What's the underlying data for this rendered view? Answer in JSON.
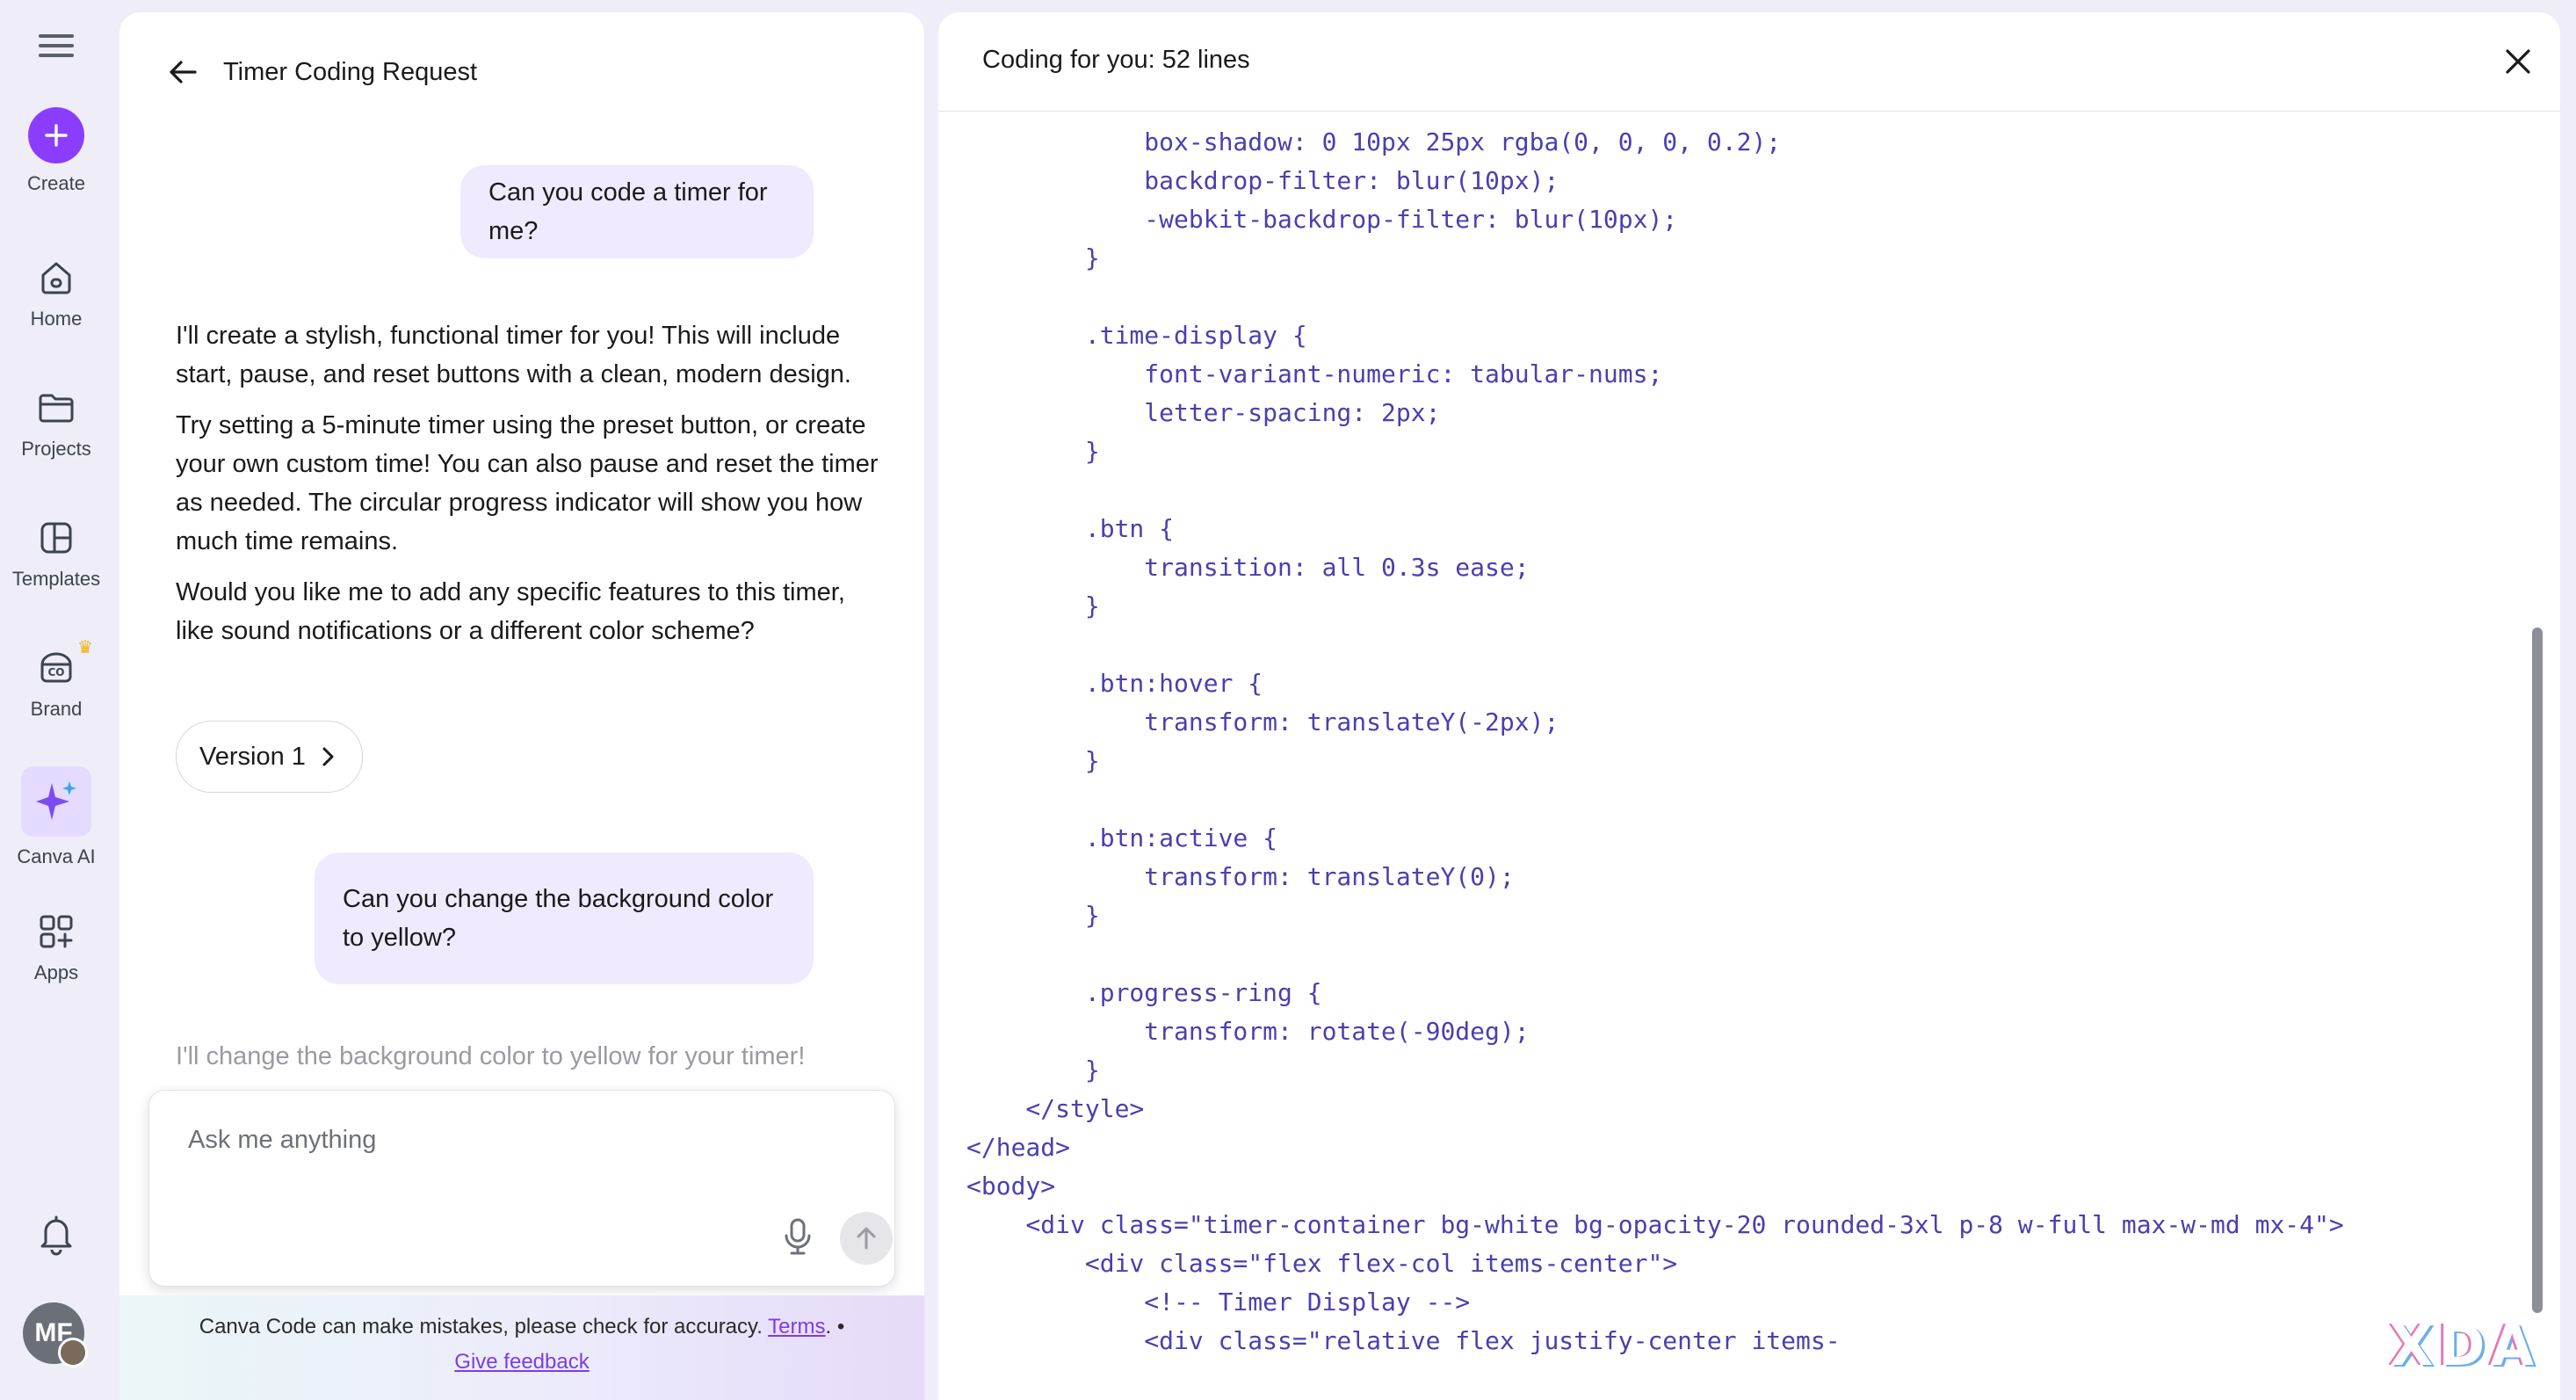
{
  "sidebar": {
    "items": [
      {
        "label": "Create"
      },
      {
        "label": "Home"
      },
      {
        "label": "Projects"
      },
      {
        "label": "Templates"
      },
      {
        "label": "Brand"
      },
      {
        "label": "Canva AI"
      },
      {
        "label": "Apps"
      }
    ],
    "avatar_initials": "MF"
  },
  "chat": {
    "title": "Timer Coding Request",
    "user_message_1": "Can you code a timer for me?",
    "ai_paragraphs": [
      "I'll create a stylish, functional timer for you! This will include start, pause, and reset buttons with a clean, modern design.",
      "Try setting a 5-minute timer using the preset button, or create your own custom time! You can also pause and reset the timer as needed. The circular progress indicator will show you how much time remains.",
      "Would you like me to add any specific features to this timer, like sound notifications or a different color scheme?"
    ],
    "version_label": "Version 1",
    "user_message_2": "Can you change the background color to yellow?",
    "ai_partial": "I'll change the background color to yellow for your timer!",
    "input_placeholder": "Ask me anything",
    "disclaimer": "Canva Code can make mistakes, please check for accuracy.",
    "terms_label": "Terms",
    "bullet": "•",
    "feedback_label": "Give feedback"
  },
  "code_panel": {
    "title": "Coding for you: 52 lines",
    "lines": [
      "            box-shadow: 0 10px 25px rgba(0, 0, 0, 0.2);",
      "            backdrop-filter: blur(10px);",
      "            -webkit-backdrop-filter: blur(10px);",
      "        }",
      "",
      "        .time-display {",
      "            font-variant-numeric: tabular-nums;",
      "            letter-spacing: 2px;",
      "        }",
      "",
      "        .btn {",
      "            transition: all 0.3s ease;",
      "        }",
      "",
      "        .btn:hover {",
      "            transform: translateY(-2px);",
      "        }",
      "",
      "        .btn:active {",
      "            transform: translateY(0);",
      "        }",
      "",
      "        .progress-ring {",
      "            transform: rotate(-90deg);",
      "        }",
      "    </style>",
      "</head>",
      "<body>",
      "    <div class=\"timer-container bg-white bg-opacity-20 rounded-3xl p-8 w-full max-w-md mx-4\">",
      "        <div class=\"flex flex-col items-center\">",
      "            <!-- Timer Display -->",
      "            <div class=\"relative flex justify-center items-"
    ]
  },
  "watermark": "XDA",
  "colors": {
    "accent": "#8b3dff",
    "bubble": "#efeafe",
    "code_text": "#4a3fb0",
    "link": "#7a3ee8"
  }
}
